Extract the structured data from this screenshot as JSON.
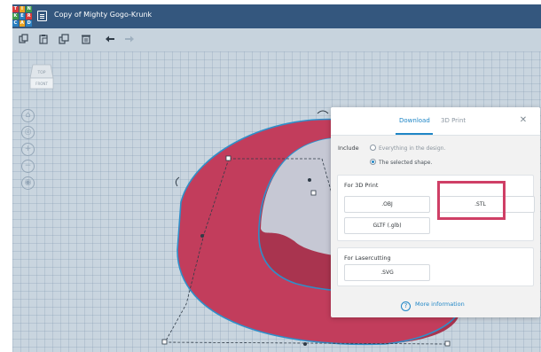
{
  "app": {
    "logo_letters": [
      "T",
      "I",
      "N",
      "K",
      "E",
      "R",
      "C",
      "A",
      "D"
    ],
    "design_title": "Copy of Mighty Gogo-Krunk"
  },
  "toolbar": {
    "icons": [
      "copy-icon",
      "paste-icon",
      "duplicate-icon",
      "trash-icon",
      "undo-icon",
      "redo-icon"
    ]
  },
  "viewcube": {
    "top_label": "TOP",
    "front_label": "FRONT"
  },
  "nav_controls": {
    "home_glyph": "⌂",
    "fit_glyph": "◎",
    "zoom_in_glyph": "+",
    "zoom_out_glyph": "−",
    "perspective_glyph": "◉"
  },
  "download_modal": {
    "tabs": {
      "download": "Download",
      "print": "3D Print"
    },
    "close_glyph": "✕",
    "include_label": "Include",
    "options": {
      "everything": "Everything in the design.",
      "selected": "The selected shape."
    },
    "selected_option": "selected",
    "sections": {
      "print3d": {
        "title": "For 3D Print",
        "obj": ".OBJ",
        "stl": ".STL",
        "gltf": "GLTF (.glb)"
      },
      "laser": {
        "title": "For Lasercutting",
        "svg": ".SVG"
      }
    },
    "more_info": "More information",
    "info_glyph": "?"
  },
  "colors": {
    "accent": "#1f86c6",
    "shape": "#c23d5c",
    "highlight": "#cf3f66",
    "topbar": "#34577e"
  }
}
